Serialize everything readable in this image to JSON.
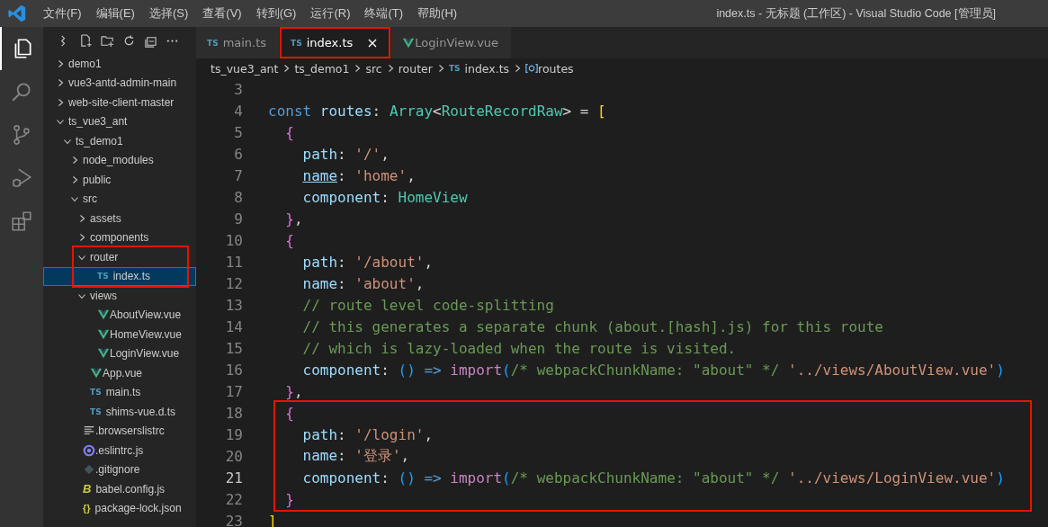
{
  "window": {
    "title": "index.ts - 无标题 (工作区) - Visual Studio Code [管理员]"
  },
  "menu": [
    "文件(F)",
    "编辑(E)",
    "选择(S)",
    "查看(V)",
    "转到(G)",
    "运行(R)",
    "终端(T)",
    "帮助(H)"
  ],
  "activity_bar": [
    {
      "kind": "explorer",
      "selected": true
    },
    {
      "kind": "search",
      "selected": false
    },
    {
      "kind": "source-control",
      "selected": false
    },
    {
      "kind": "run-debug",
      "selected": false
    },
    {
      "kind": "extensions",
      "selected": false
    }
  ],
  "explorer_toolbar": [
    {
      "kind": "filter"
    },
    {
      "kind": "new-file"
    },
    {
      "kind": "new-folder"
    },
    {
      "kind": "refresh"
    },
    {
      "kind": "collapse"
    },
    {
      "kind": "more"
    }
  ],
  "tree": [
    {
      "label": "demo1",
      "kind": "folder",
      "expanded": false
    },
    {
      "label": "vue3-antd-admin-main",
      "kind": "folder",
      "expanded": false
    },
    {
      "label": "web-site-client-master",
      "kind": "folder",
      "expanded": false
    },
    {
      "label": "ts_vue3_ant",
      "kind": "folder",
      "expanded": true,
      "children": [
        {
          "label": "ts_demo1",
          "kind": "folder",
          "expanded": true,
          "children": [
            {
              "label": "node_modules",
              "kind": "folder",
              "expanded": false
            },
            {
              "label": "public",
              "kind": "folder",
              "expanded": false
            },
            {
              "label": "src",
              "kind": "folder",
              "expanded": true,
              "children": [
                {
                  "label": "assets",
                  "kind": "folder",
                  "expanded": false
                },
                {
                  "label": "components",
                  "kind": "folder",
                  "expanded": false
                },
                {
                  "label": "router",
                  "kind": "folder",
                  "expanded": true,
                  "highlighted": true,
                  "children": [
                    {
                      "label": "index.ts",
                      "kind": "ts",
                      "icon_text": "TS",
                      "selected": true,
                      "highlighted": true
                    }
                  ]
                },
                {
                  "label": "views",
                  "kind": "folder",
                  "expanded": true,
                  "children": [
                    {
                      "label": "AboutView.vue",
                      "kind": "vue",
                      "selected": false
                    },
                    {
                      "label": "HomeView.vue",
                      "kind": "vue",
                      "selected": false
                    },
                    {
                      "label": "LoginView.vue",
                      "kind": "vue",
                      "selected": false
                    }
                  ]
                },
                {
                  "label": "App.vue",
                  "kind": "vue",
                  "selected": false
                },
                {
                  "label": "main.ts",
                  "kind": "ts",
                  "icon_text": "TS",
                  "selected": false
                },
                {
                  "label": "shims-vue.d.ts",
                  "kind": "ts",
                  "icon_text": "TS",
                  "selected": false
                }
              ]
            },
            {
              "label": ".browserslistrc",
              "kind": "lines",
              "selected": false
            },
            {
              "label": ".eslintrc.js",
              "kind": "eslint",
              "selected": false
            },
            {
              "label": ".gitignore",
              "kind": "git",
              "selected": false
            },
            {
              "label": "babel.config.js",
              "kind": "babel",
              "icon_text": "B",
              "selected": false
            },
            {
              "label": "package-lock.json",
              "kind": "json",
              "icon_text": "{}",
              "selected": false
            }
          ]
        }
      ]
    }
  ],
  "tabs": [
    {
      "label": "main.ts",
      "kind": "ts",
      "icon_text": "TS",
      "selected": false,
      "highlighted": false
    },
    {
      "label": "index.ts",
      "kind": "ts",
      "icon_text": "TS",
      "selected": true,
      "highlighted": true
    },
    {
      "label": "LoginView.vue",
      "kind": "vue",
      "selected": false,
      "highlighted": false
    }
  ],
  "breadcrumbs": [
    {
      "label": "ts_vue3_ant"
    },
    {
      "label": "ts_demo1"
    },
    {
      "label": "src"
    },
    {
      "label": "router"
    },
    {
      "label": "index.ts",
      "kind": "ts",
      "icon_text": "TS"
    },
    {
      "label": "routes",
      "kind": "symbol"
    }
  ],
  "code": {
    "lines": [
      {
        "number": "3",
        "current": false
      },
      {
        "number": "4",
        "current": false,
        "tokens": [
          {
            "t": "const",
            "kind": "kw"
          },
          {
            "t": " routes",
            "kind": "var"
          },
          {
            "t": ": ",
            "kind": "plain"
          },
          {
            "t": "Array",
            "kind": "type"
          },
          {
            "t": "<",
            "kind": "plain"
          },
          {
            "t": "RouteRecordRaw",
            "kind": "type"
          },
          {
            "t": "> = ",
            "kind": "plain"
          },
          {
            "t": "[",
            "kind": "b1"
          }
        ]
      },
      {
        "number": "5",
        "current": false,
        "tokens": [
          {
            "t": "  {",
            "kind": "b2"
          }
        ]
      },
      {
        "number": "6",
        "current": false,
        "tokens": [
          {
            "t": "    path",
            "kind": "prop"
          },
          {
            "t": ": ",
            "kind": "plain"
          },
          {
            "t": "'/'",
            "kind": "str"
          },
          {
            "t": ",",
            "kind": "plain"
          }
        ]
      },
      {
        "number": "7",
        "current": false,
        "tokens": [
          {
            "t": "    name",
            "kind": "prop",
            "underline": true
          },
          {
            "t": ": ",
            "kind": "plain"
          },
          {
            "t": "'home'",
            "kind": "str"
          },
          {
            "t": ",",
            "kind": "plain"
          }
        ]
      },
      {
        "number": "8",
        "current": false,
        "tokens": [
          {
            "t": "    component",
            "kind": "prop"
          },
          {
            "t": ": ",
            "kind": "plain"
          },
          {
            "t": "HomeView",
            "kind": "type"
          }
        ]
      },
      {
        "number": "9",
        "current": false,
        "tokens": [
          {
            "t": "  }",
            "kind": "b2"
          },
          {
            "t": ",",
            "kind": "plain"
          }
        ]
      },
      {
        "number": "10",
        "current": false,
        "tokens": [
          {
            "t": "  {",
            "kind": "b2"
          }
        ]
      },
      {
        "number": "11",
        "current": false,
        "tokens": [
          {
            "t": "    path",
            "kind": "prop"
          },
          {
            "t": ": ",
            "kind": "plain"
          },
          {
            "t": "'/about'",
            "kind": "str"
          },
          {
            "t": ",",
            "kind": "plain"
          }
        ]
      },
      {
        "number": "12",
        "current": false,
        "tokens": [
          {
            "t": "    name",
            "kind": "prop"
          },
          {
            "t": ": ",
            "kind": "plain"
          },
          {
            "t": "'about'",
            "kind": "str"
          },
          {
            "t": ",",
            "kind": "plain"
          }
        ]
      },
      {
        "number": "13",
        "current": false,
        "tokens": [
          {
            "t": "    // route level code-splitting",
            "kind": "comment"
          }
        ]
      },
      {
        "number": "14",
        "current": false,
        "tokens": [
          {
            "t": "    // this generates a separate chunk (about.[hash].js) for this route",
            "kind": "comment"
          }
        ]
      },
      {
        "number": "15",
        "current": false,
        "tokens": [
          {
            "t": "    // which is lazy-loaded when the route is visited.",
            "kind": "comment"
          }
        ]
      },
      {
        "number": "16",
        "current": false,
        "tokens": [
          {
            "t": "    component",
            "kind": "prop"
          },
          {
            "t": ": ",
            "kind": "plain"
          },
          {
            "t": "()",
            "kind": "b3"
          },
          {
            "t": " => ",
            "kind": "kw"
          },
          {
            "t": "import",
            "kind": "ctrl"
          },
          {
            "t": "(",
            "kind": "b3"
          },
          {
            "t": "/* webpackChunkName: \"about\" */",
            "kind": "comment"
          },
          {
            "t": " '../views/AboutView.vue'",
            "kind": "str"
          },
          {
            "t": ")",
            "kind": "b3"
          }
        ]
      },
      {
        "number": "17",
        "current": false,
        "tokens": [
          {
            "t": "  }",
            "kind": "b2"
          },
          {
            "t": ",",
            "kind": "plain"
          }
        ]
      },
      {
        "number": "18",
        "current": false,
        "highlighted": true,
        "tokens": [
          {
            "t": "  {",
            "kind": "b2"
          }
        ]
      },
      {
        "number": "19",
        "current": false,
        "highlighted": true,
        "tokens": [
          {
            "t": "    path",
            "kind": "prop"
          },
          {
            "t": ": ",
            "kind": "plain"
          },
          {
            "t": "'/login'",
            "kind": "str"
          },
          {
            "t": ",",
            "kind": "plain"
          }
        ]
      },
      {
        "number": "20",
        "current": false,
        "highlighted": true,
        "tokens": [
          {
            "t": "    name",
            "kind": "prop"
          },
          {
            "t": ": ",
            "kind": "plain"
          },
          {
            "t": "'登录'",
            "kind": "str"
          },
          {
            "t": ",",
            "kind": "plain"
          }
        ]
      },
      {
        "number": "21",
        "current": true,
        "highlighted": true,
        "tokens": [
          {
            "t": "    component",
            "kind": "prop"
          },
          {
            "t": ": ",
            "kind": "plain"
          },
          {
            "t": "()",
            "kind": "b3"
          },
          {
            "t": " => ",
            "kind": "kw"
          },
          {
            "t": "import",
            "kind": "ctrl"
          },
          {
            "t": "(",
            "kind": "b3"
          },
          {
            "t": "/* webpackChunkName: \"about\" */",
            "kind": "comment"
          },
          {
            "t": " '../views/LoginView.vue'",
            "kind": "str"
          },
          {
            "t": ")",
            "kind": "b3"
          }
        ]
      },
      {
        "number": "22",
        "current": false,
        "highlighted": true,
        "tokens": [
          {
            "t": "  }",
            "kind": "b2"
          }
        ]
      },
      {
        "number": "23",
        "current": false,
        "tokens": [
          {
            "t": "]",
            "kind": "b1"
          }
        ]
      }
    ]
  }
}
